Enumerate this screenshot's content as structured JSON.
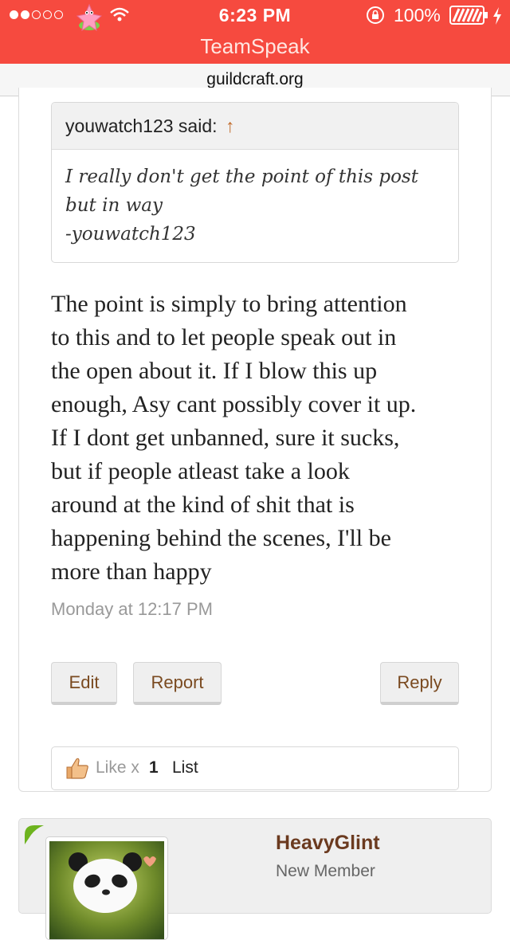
{
  "status_bar": {
    "time": "6:23 PM",
    "battery": "100%",
    "app": "TeamSpeak",
    "icons": [
      "signal-dots",
      "patrick-icon",
      "wifi-icon",
      "rotation-lock-icon",
      "battery-icon",
      "bolt-icon"
    ]
  },
  "browser": {
    "url": "guildcraft.org"
  },
  "quote": {
    "author": "youwatch123 said:",
    "arrow": "↑",
    "lines": [
      "I really don't get the point of this post",
      "but in way",
      "-youwatch123"
    ]
  },
  "post": {
    "lines": [
      "The point is simply to bring attention",
      "to this and to let people speak out in",
      "the open about it. If I blow this up",
      "enough, Asy cant possibly cover it up.",
      "If I dont get unbanned, sure it sucks,",
      "but if people atleast take a look",
      "around at the kind of shit that is",
      "happening behind the scenes, I'll be",
      "more than happy"
    ],
    "timestamp": "Monday at 12:17 PM"
  },
  "actions": {
    "edit": "Edit",
    "report": "Report",
    "reply": "Reply"
  },
  "likes": {
    "label": "Like x",
    "count": "1",
    "list": "List"
  },
  "next_post": {
    "username": "HeavyGlint",
    "title": "New Member"
  },
  "colors": {
    "status_bar": "#f64a3f",
    "link_brown": "#7a4a20",
    "username": "#6b3a1f",
    "corner_green": "#6db31e"
  }
}
